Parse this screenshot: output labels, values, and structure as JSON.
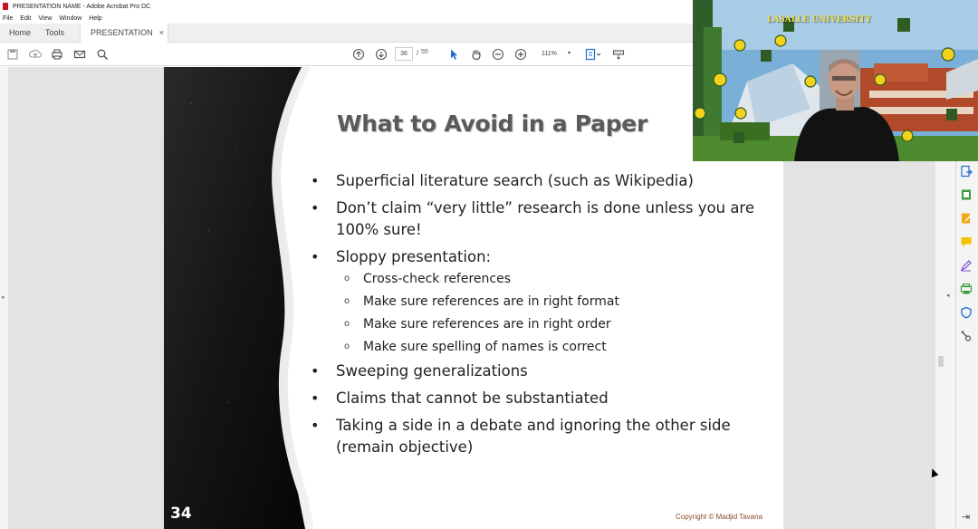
{
  "window": {
    "title": "PRESENTATION NAME - Adobe Acrobat Pro DC",
    "menu": [
      "File",
      "Edit",
      "View",
      "Window",
      "Help"
    ]
  },
  "tabs": {
    "home": "Home",
    "tools": "Tools",
    "document": "PRESENTATION  NA...",
    "close_glyph": "×"
  },
  "toolbar": {
    "page_current": "36",
    "page_separator": "/",
    "page_total": "55",
    "zoom": "111%",
    "zoom_caret": "▾",
    "icons": [
      "save-icon",
      "upload-icon",
      "print-icon",
      "email-icon",
      "search-icon",
      "page-up-icon",
      "page-down-icon",
      "select-cursor-icon",
      "hand-icon",
      "zoom-out-icon",
      "zoom-in-icon",
      "fit-page-icon",
      "keyboard-icon"
    ]
  },
  "slide": {
    "title": "What to Avoid in a Paper",
    "bullets": [
      "Superficial literature search (such as Wikipedia)",
      "Don’t claim “very little” research is done unless you are 100% sure!",
      "Sloppy presentation:",
      "Sweeping generalizations",
      "Claims that cannot be substantiated",
      "Taking a side in a debate and ignoring the other side (remain objective)"
    ],
    "sub_bullets": [
      "Cross-check references",
      "Make sure references are in right format",
      "Make sure references are in right order",
      "Make sure spelling of names is correct"
    ],
    "number": "34",
    "copyright": "Copyright © Madjid Tavana"
  },
  "right_rail": {
    "icons": [
      "export-pdf-icon",
      "create-pdf-icon",
      "edit-pdf-icon",
      "comment-icon",
      "fill-sign-icon",
      "organize-pages-icon",
      "protect-icon",
      "more-tools-icon"
    ],
    "collapse_glyph": "◂",
    "bottom_glyph": "⇥"
  },
  "left_panel": {
    "collapse_glyph": "▸"
  },
  "webcam": {
    "sign": "LASALLE UNIVERSITY",
    "colors": {
      "sky": "#7ab0d8",
      "brick": "#b04a2a",
      "gold": "#f2d21c",
      "grass": "#4e8a2e"
    }
  }
}
